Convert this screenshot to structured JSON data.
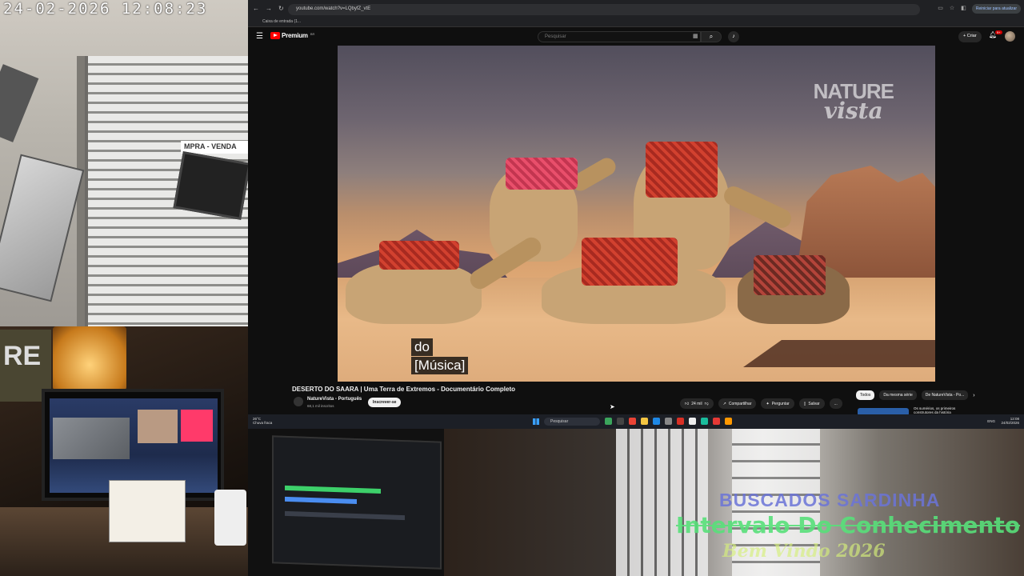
{
  "camera_feed": {
    "timestamp": "24-02-2026  12:08:23",
    "shop_sign": "MPRA - VENDA"
  },
  "stream_overlay": {
    "line1": "BUSCADOS SARDINHA",
    "line2": "Intervalo Do Conhecimento",
    "line3": "Bem Vindo 2026"
  },
  "browser": {
    "url": "youtube.com/watch?v=LQbyfZ_vtE",
    "bookmark": "Caixa de entrada (1...",
    "reload_label": "Reiniciar para atualizar"
  },
  "youtube_header": {
    "logo_text": "Premium",
    "logo_region": "BR",
    "search_placeholder": "Pesquisar",
    "create_label": "Criar",
    "notifications_count": "9+"
  },
  "video": {
    "watermark_line1": "NATURE",
    "watermark_line2": "vista",
    "caption_line1": "do",
    "caption_line2": "[Música]"
  },
  "video_meta": {
    "title": "DESERTO DO SAARA | Uma Terra de Extremos - Documentário Completo",
    "channel_name": "NatureVista - Português",
    "subscribers": "68,1 mil inscritos",
    "subscribe_label": "Inscrever-se",
    "likes": "24 mil",
    "share_label": "Compartilhar",
    "ask_label": "Perguntar",
    "save_label": "Salvar",
    "more_label": "..."
  },
  "recommendations": {
    "chips": [
      "Todos",
      "Da mesma série",
      "De NatureVista - Po..."
    ],
    "first_title": "Os sumérios, os primeiros construtores da história"
  },
  "taskbar": {
    "weather_temp": "26°C",
    "weather_desc": "Chuva fraca",
    "search_placeholder": "Pesquisar",
    "lang": "ENG",
    "time": "12:08",
    "date": "24/02/2026"
  },
  "colors": {
    "youtube_red": "#ff0000",
    "page_bg": "#0f0f0f",
    "overlay_green": "#58e07a",
    "overlay_blue": "#6b74d8"
  }
}
